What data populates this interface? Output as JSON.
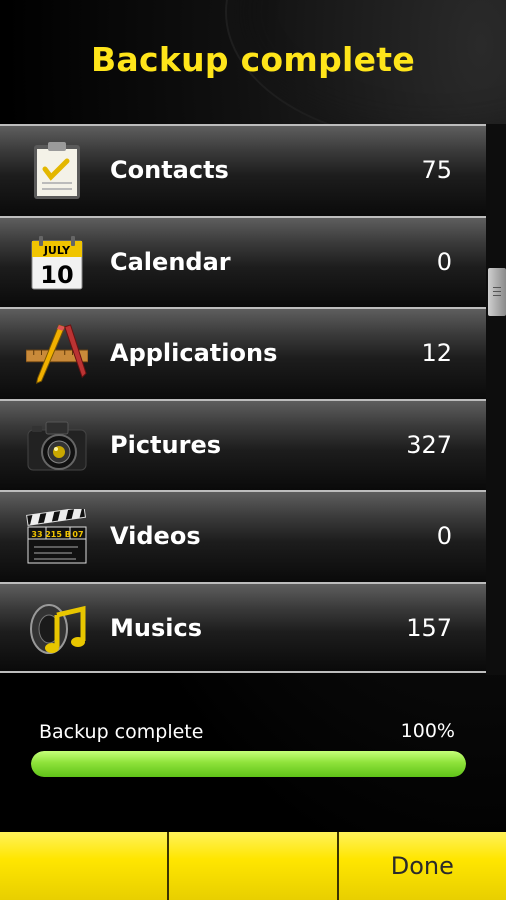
{
  "header": {
    "title": "Backup complete"
  },
  "items": [
    {
      "label": "Contacts",
      "count": "75",
      "icon": "clipboard-icon"
    },
    {
      "label": "Calendar",
      "count": "0",
      "icon": "calendar-icon",
      "icon_text": {
        "month": "JULY",
        "day": "10"
      }
    },
    {
      "label": "Applications",
      "count": "12",
      "icon": "ruler-pencil-icon"
    },
    {
      "label": "Pictures",
      "count": "327",
      "icon": "camera-icon"
    },
    {
      "label": "Videos",
      "count": "0",
      "icon": "clapperboard-icon",
      "icon_text": {
        "a": "33",
        "b": "215 B",
        "c": "07"
      }
    },
    {
      "label": "Musics",
      "count": "157",
      "icon": "music-note-icon"
    }
  ],
  "progress": {
    "label": "Backup complete",
    "percent_text": "100%",
    "value": 1.0
  },
  "bottom_bar": {
    "buttons": [
      "",
      "",
      "Done"
    ]
  },
  "colors": {
    "title": "#ffe51a",
    "bar_yellow": "#ffe600",
    "progress_green": "#8ee23a"
  }
}
